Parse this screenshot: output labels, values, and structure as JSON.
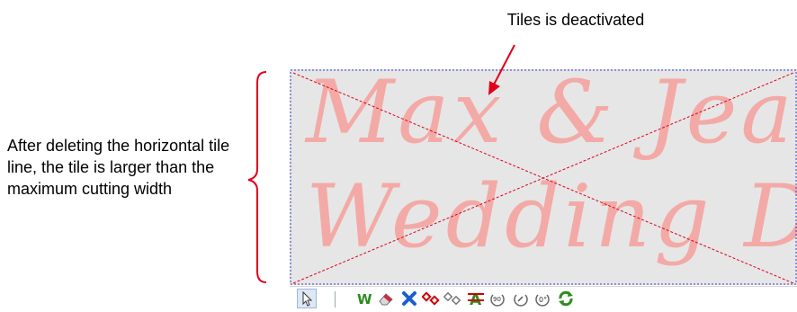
{
  "annotations": {
    "tiles_label": "Tiles is deactivated",
    "explanation": "After deleting the horizontal tile line, the tile is larger than the maximum cutting width"
  },
  "canvas": {
    "text_line_1": "Max & Jean's",
    "text_line_2": "Wedding Day",
    "text_color": "#f3aaa6",
    "background": "#e6e6e6",
    "dashed_line_color": "#e0001a",
    "tile_border_color": "#3a3ad0"
  },
  "toolbar": {
    "tools": [
      {
        "name": "select-arrow-icon"
      },
      {
        "name": "weed-w-icon"
      },
      {
        "name": "eraser-icon"
      },
      {
        "name": "delete-x-icon"
      },
      {
        "name": "add-node-icon"
      },
      {
        "name": "remove-node-icon"
      },
      {
        "name": "strikethrough-a-icon"
      },
      {
        "name": "rotate-90-icon"
      },
      {
        "name": "rotate-custom-icon"
      },
      {
        "name": "rotate-0-icon"
      },
      {
        "name": "refresh-icon"
      }
    ],
    "rotate_90_label": "90",
    "rotate_0_label": "0°"
  }
}
